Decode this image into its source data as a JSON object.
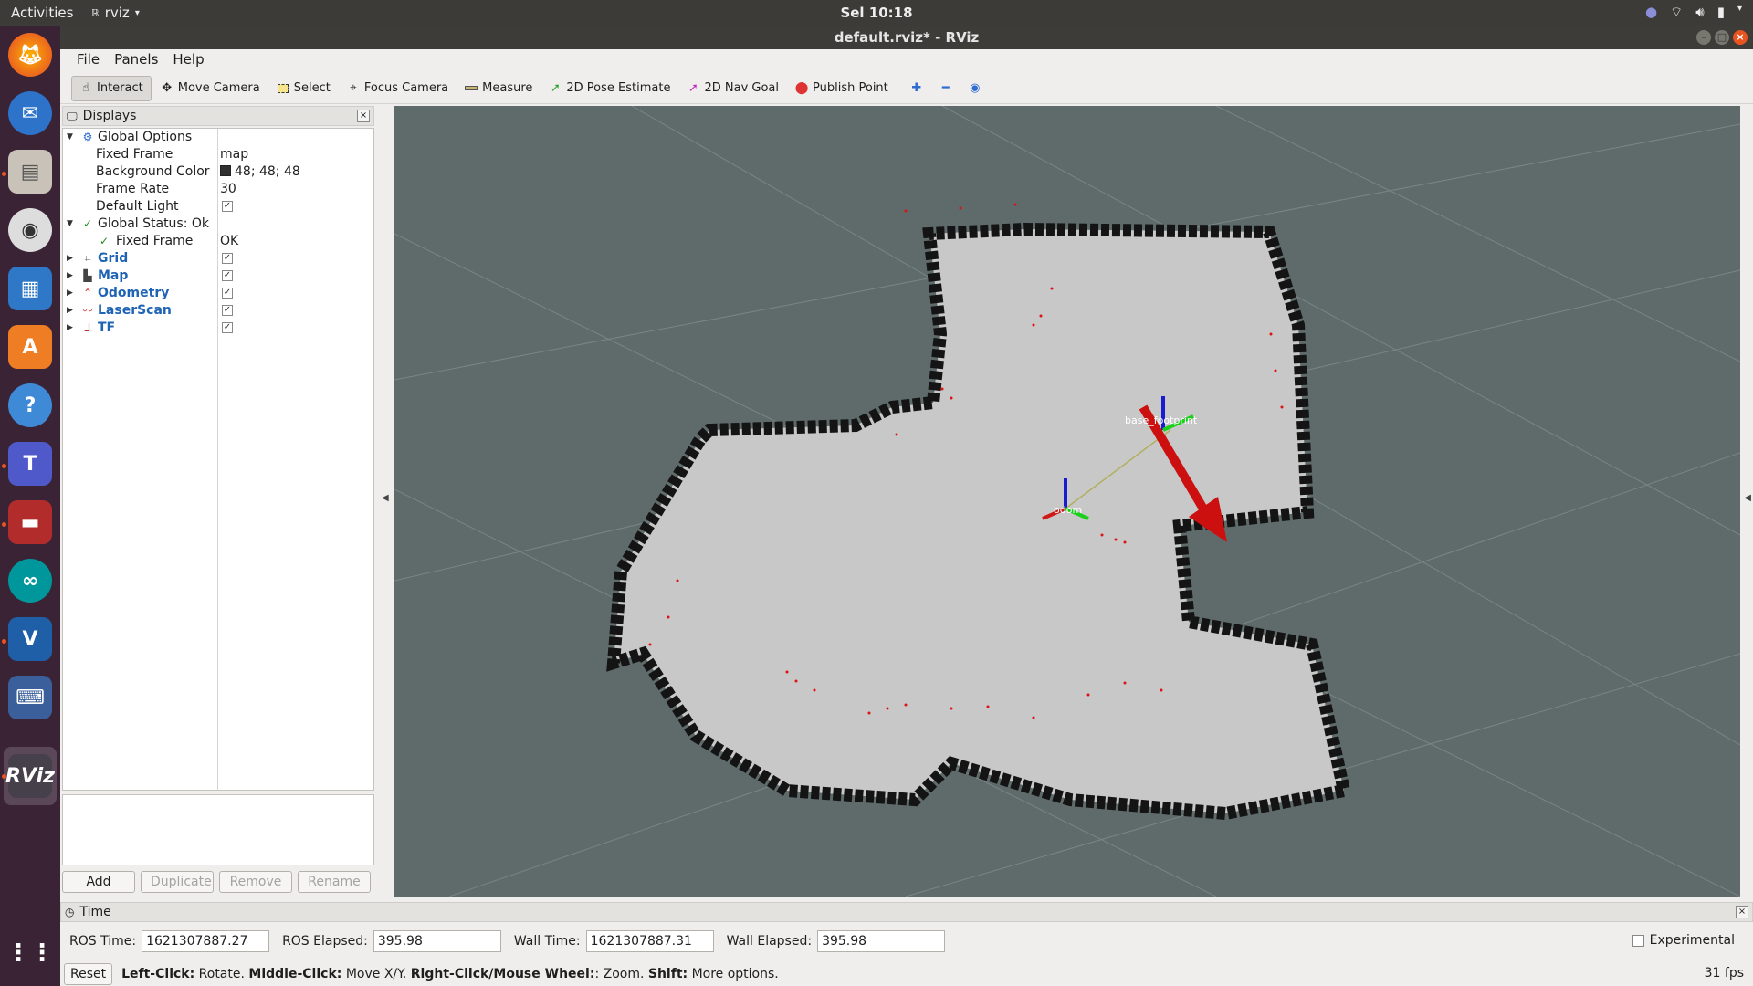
{
  "topbar": {
    "activities": "Activities",
    "app_name": "rviz",
    "clock": "Sel 10:18"
  },
  "window": {
    "title": "default.rviz* - RViz"
  },
  "menu": [
    "File",
    "Panels",
    "Help"
  ],
  "toolbar": {
    "interact": "Interact",
    "move_camera": "Move Camera",
    "select": "Select",
    "focus_camera": "Focus Camera",
    "measure": "Measure",
    "pose_estimate": "2D Pose Estimate",
    "nav_goal": "2D Nav Goal",
    "publish_point": "Publish Point"
  },
  "displays": {
    "title": "Displays",
    "global_options": "Global Options",
    "fixed_frame_label": "Fixed Frame",
    "fixed_frame_value": "map",
    "bg_color_label": "Background Color",
    "bg_color_value": "48; 48; 48",
    "frame_rate_label": "Frame Rate",
    "frame_rate_value": "30",
    "default_light_label": "Default Light",
    "global_status": "Global Status: Ok",
    "status_fixed_frame": "Fixed Frame",
    "status_fixed_frame_value": "OK",
    "items": [
      "Grid",
      "Map",
      "Odometry",
      "LaserScan",
      "TF"
    ],
    "buttons": {
      "add": "Add",
      "duplicate": "Duplicate",
      "remove": "Remove",
      "rename": "Rename"
    }
  },
  "view": {
    "frame_labels": {
      "base": "base_footprint",
      "odom": "odom"
    }
  },
  "time": {
    "title": "Time",
    "ros_time_label": "ROS Time:",
    "ros_time": "1621307887.27",
    "ros_elapsed_label": "ROS Elapsed:",
    "ros_elapsed": "395.98",
    "wall_time_label": "Wall Time:",
    "wall_time": "1621307887.31",
    "wall_elapsed_label": "Wall Elapsed:",
    "wall_elapsed": "395.98",
    "experimental": "Experimental"
  },
  "status": {
    "reset": "Reset",
    "hint_left_bold": "Left-Click:",
    "hint_left": "Rotate.",
    "hint_mid_bold": "Middle-Click:",
    "hint_mid": "Move X/Y.",
    "hint_right_bold": "Right-Click/Mouse Wheel:",
    "hint_right": ": Zoom.",
    "hint_shift_bold": "Shift:",
    "hint_shift": "More options.",
    "fps": "31 fps"
  },
  "colors": {
    "accent": "#e95420",
    "link": "#1f63b5",
    "view_bg": "#5f6a6a"
  }
}
